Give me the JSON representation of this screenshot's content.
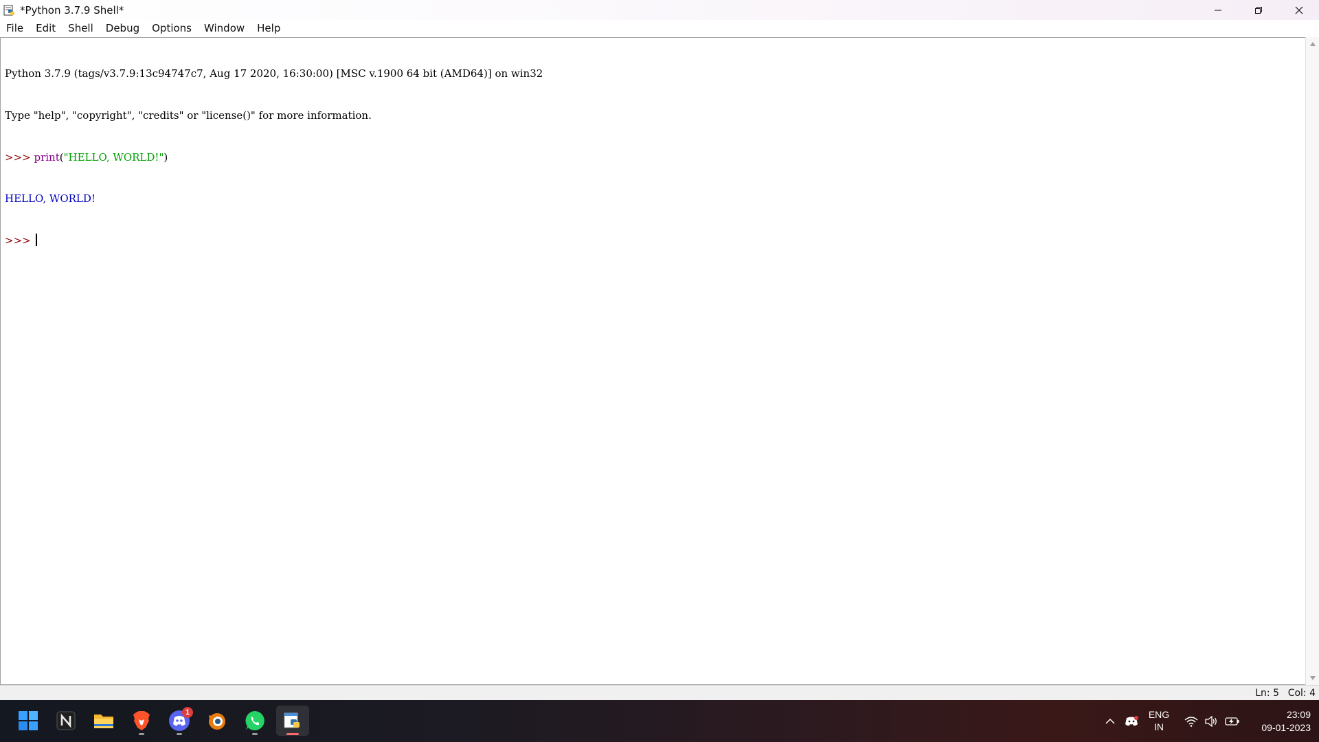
{
  "window": {
    "title": "*Python 3.7.9 Shell*"
  },
  "menu": {
    "items": [
      "File",
      "Edit",
      "Shell",
      "Debug",
      "Options",
      "Window",
      "Help"
    ]
  },
  "shell": {
    "banner_line1": "Python 3.7.9 (tags/v3.7.9:13c94747c7, Aug 17 2020, 16:30:00) [MSC v.1900 64 bit (AMD64)] on win32",
    "banner_line2": "Type \"help\", \"copyright\", \"credits\" or \"license()\" for more information.",
    "prompt": ">>> ",
    "input_builtin": "print",
    "input_open": "(",
    "input_string": "\"HELLO, WORLD!\"",
    "input_close": ")",
    "output": "HELLO, WORLD!"
  },
  "status": {
    "ln": "Ln: 5",
    "col": "Col: 4"
  },
  "taskbar": {
    "apps": [
      "windows-start",
      "notion",
      "file-explorer",
      "brave",
      "discord",
      "blender",
      "whatsapp",
      "python-idle"
    ],
    "discord_badge": "1",
    "language_line1": "ENG",
    "language_line2": "IN",
    "time": "23:09",
    "date": "09-01-2023"
  },
  "colors": {
    "prompt": "#8b0000",
    "builtin": "#900090",
    "string": "#00a000",
    "stdout": "#0000c0"
  }
}
